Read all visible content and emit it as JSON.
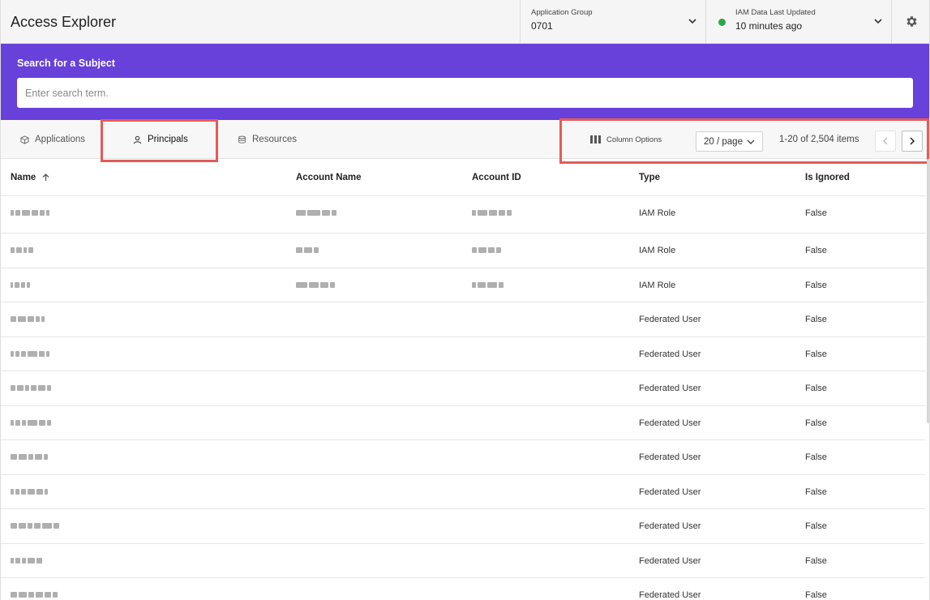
{
  "header": {
    "title": "Access Explorer",
    "app_group": {
      "label": "Application Group",
      "value": "0701"
    },
    "iam": {
      "label": "IAM Data Last Updated",
      "value": "10 minutes ago",
      "status_color": "#2ba84a"
    },
    "settings_icon": "gear-icon"
  },
  "search": {
    "title": "Search for a Subject",
    "placeholder": "Enter search term.",
    "banner_color": "#6741d9"
  },
  "tabs": [
    {
      "label": "Applications",
      "icon": "cube-icon"
    },
    {
      "label": "Principals",
      "icon": "user-icon",
      "selected": true
    },
    {
      "label": "Resources",
      "icon": "database-icon"
    }
  ],
  "toolbar": {
    "column_options": "Column Options",
    "page_size": "20 / page",
    "range": "1-20 of 2,504 items"
  },
  "highlight_color": "#e45b58",
  "table": {
    "columns": [
      "Name",
      "Account Name",
      "Account ID",
      "Type",
      "Is Ignored"
    ],
    "rows": [
      {
        "type": "IAM Role",
        "ignored": "False"
      },
      {
        "type": "IAM Role",
        "ignored": "False"
      },
      {
        "type": "IAM Role",
        "ignored": "False"
      },
      {
        "type": "Federated User",
        "ignored": "False"
      },
      {
        "type": "Federated User",
        "ignored": "False"
      },
      {
        "type": "Federated User",
        "ignored": "False"
      },
      {
        "type": "Federated User",
        "ignored": "False"
      },
      {
        "type": "Federated User",
        "ignored": "False"
      },
      {
        "type": "Federated User",
        "ignored": "False"
      },
      {
        "type": "Federated User",
        "ignored": "False"
      },
      {
        "type": "Federated User",
        "ignored": "False"
      },
      {
        "type": "Federated User",
        "ignored": "False"
      }
    ]
  }
}
